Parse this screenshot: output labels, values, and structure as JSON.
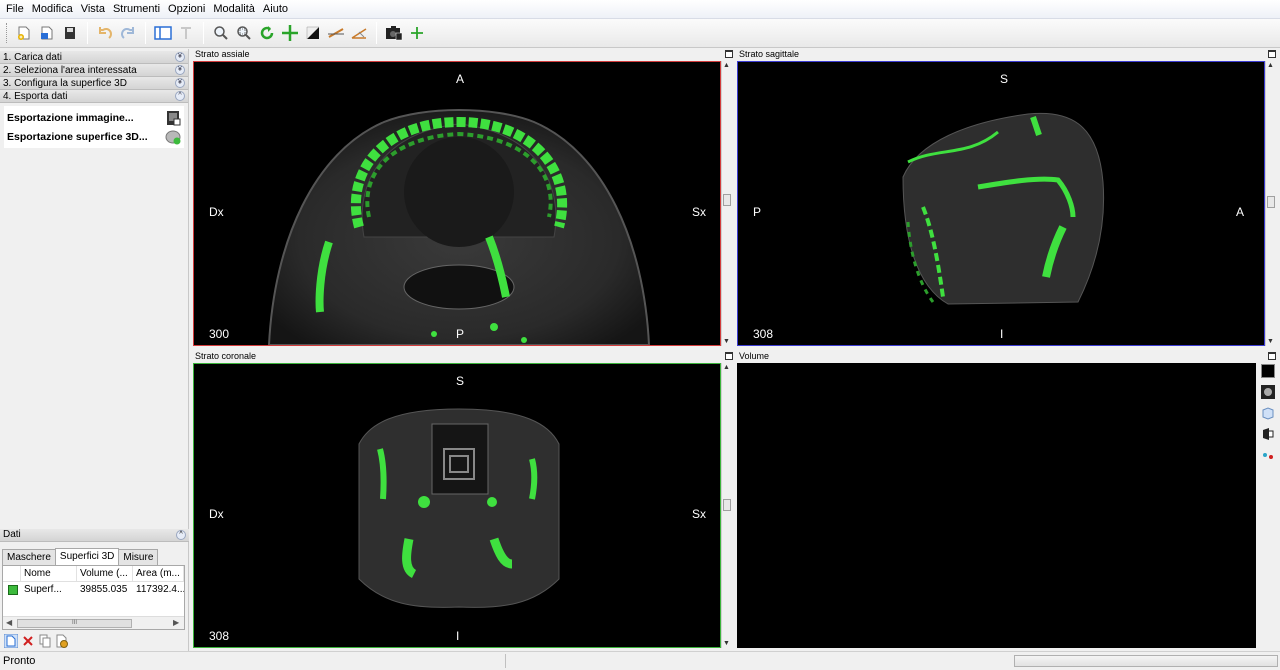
{
  "menu": [
    "File",
    "Modifica",
    "Vista",
    "Strumenti",
    "Opzioni",
    "Modalità",
    "Aiuto"
  ],
  "workflow": {
    "steps": [
      {
        "label": "1. Carica dati",
        "chev": "¥"
      },
      {
        "label": "2. Seleziona l'area interessata",
        "chev": "¥"
      },
      {
        "label": "3. Configura la superfice 3D",
        "chev": "¥"
      },
      {
        "label": "4. Esporta dati",
        "chev": "^"
      }
    ],
    "export": {
      "image_label": "Esportazione immagine...",
      "surface_label": "Esportazione superfice 3D..."
    }
  },
  "dati": {
    "title": "Dati",
    "tabs": [
      "Maschere",
      "Superfici 3D",
      "Misure"
    ],
    "active_tab": 1,
    "columns": [
      "Nome",
      "Volume (...",
      "Area (m..."
    ],
    "rows": [
      {
        "name": "Superf...",
        "volume": "39855.035",
        "area": "117392.4..."
      }
    ],
    "scroll_thumb": "III"
  },
  "views": {
    "axial": {
      "title": "Strato assiale",
      "top": "A",
      "left": "Dx",
      "right": "Sx",
      "bottom": "P",
      "slice": "300",
      "border": "#d23c3c"
    },
    "sagittal": {
      "title": "Strato sagittale",
      "top": "S",
      "left": "P",
      "right": "A",
      "bottom": "I",
      "slice": "308",
      "border": "#3c3cd2"
    },
    "coronal": {
      "title": "Strato coronale",
      "top": "S",
      "left": "Dx",
      "right": "Sx",
      "bottom": "I",
      "slice": "308",
      "border": "#3cb43c"
    },
    "volume": {
      "title": "Volume"
    }
  },
  "status": {
    "text": "Pronto"
  },
  "colors": {
    "bone_green": "#3fe03f",
    "accent": "#2a6fd6"
  }
}
